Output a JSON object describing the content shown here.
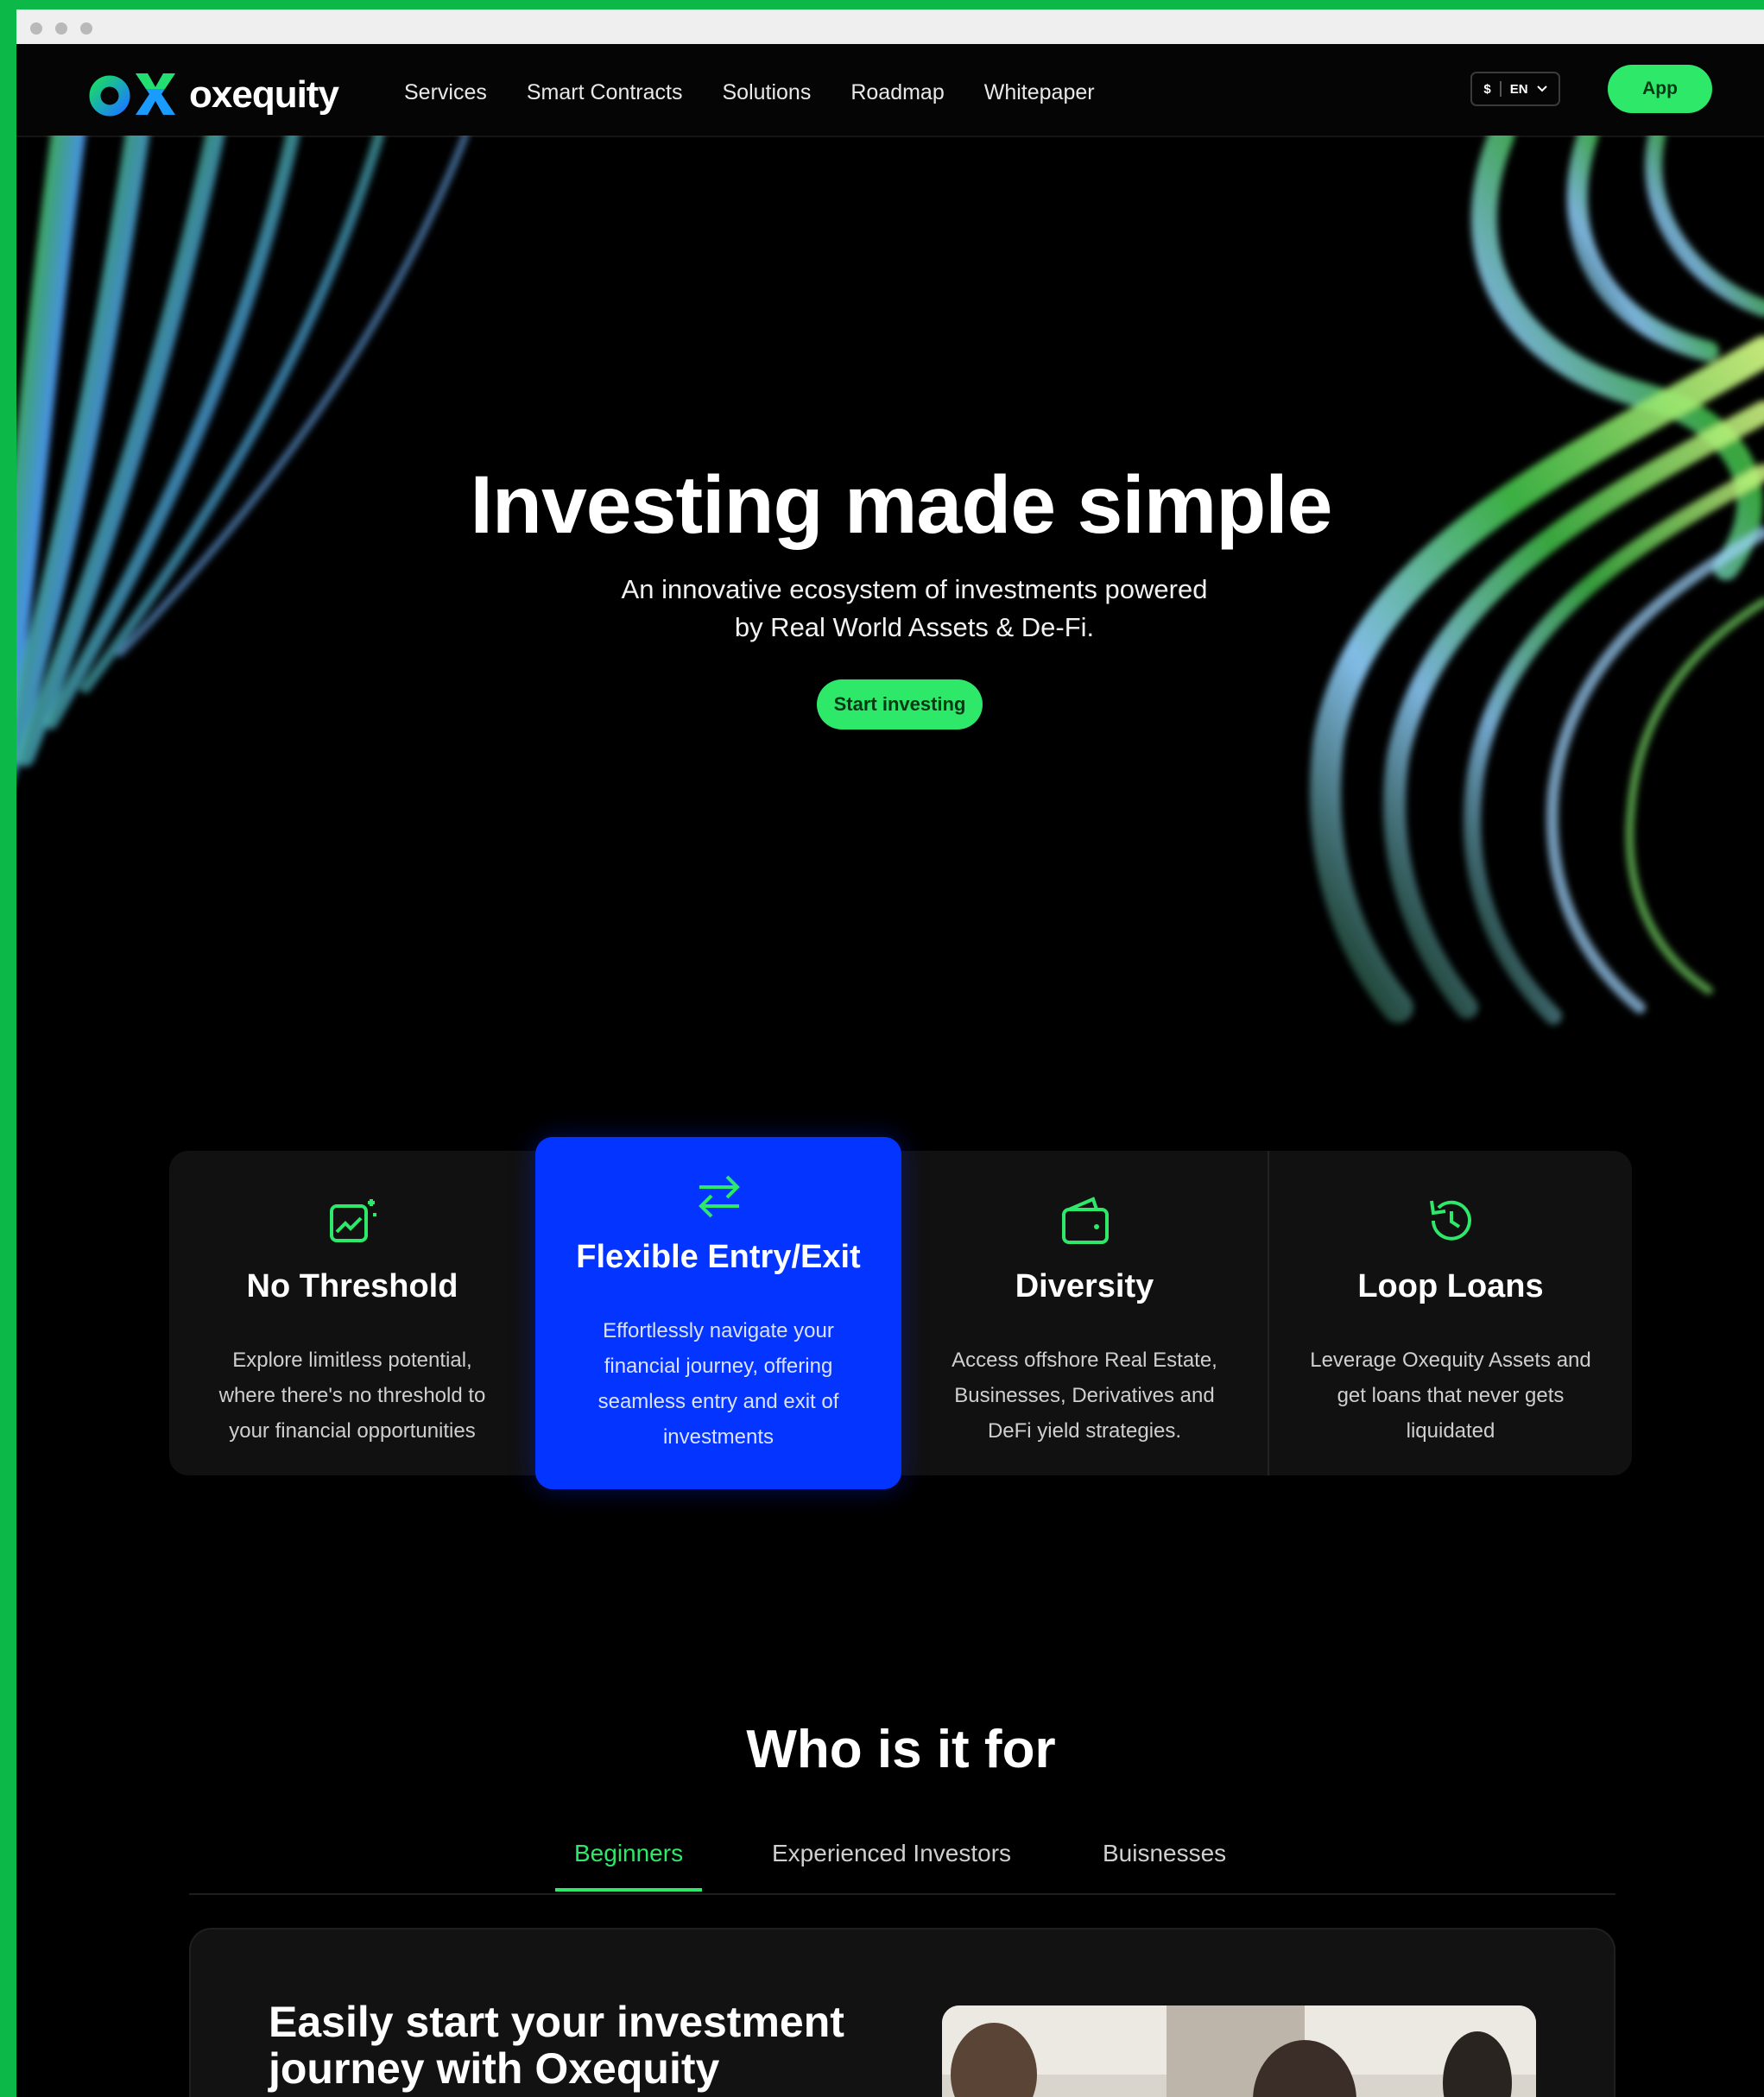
{
  "nav": {
    "brand": "oxequity",
    "links": [
      "Services",
      "Smart Contracts",
      "Solutions",
      "Roadmap",
      "Whitepaper"
    ],
    "currency": "$",
    "language": "EN",
    "app_button": "App"
  },
  "hero": {
    "title": "Investing made simple",
    "subtitle_line1": "An innovative ecosystem of investments powered",
    "subtitle_line2": "by Real World Assets & De-Fi.",
    "cta": "Start investing"
  },
  "features": [
    {
      "icon": "image-sparkle-icon",
      "title": "No Threshold",
      "description": "Explore limitless potential, where there's no threshold to your financial opportunities"
    },
    {
      "icon": "arrows-swap-icon",
      "title": "Flexible Entry/Exit",
      "description": "Effortlessly navigate your financial journey, offering seamless entry and exit of investments"
    },
    {
      "icon": "wallet-icon",
      "title": "Diversity",
      "description": "Access offshore Real Estate, Businesses, Derivatives and DeFi yield strategies."
    },
    {
      "icon": "history-clock-icon",
      "title": "Loop Loans",
      "description": "Leverage Oxequity Assets and get loans that never gets liquidated"
    }
  ],
  "who": {
    "title": "Who is it for",
    "tabs": [
      "Beginners",
      "Experienced Investors",
      "Buisnesses"
    ],
    "active_tab": "Beginners",
    "panel_title": "Easily start your investment journey with Oxequity"
  },
  "colors": {
    "accent_green": "#2ee86a",
    "active_card_blue": "#0434ff",
    "background": "#000000",
    "frame_green": "#0bb848"
  }
}
